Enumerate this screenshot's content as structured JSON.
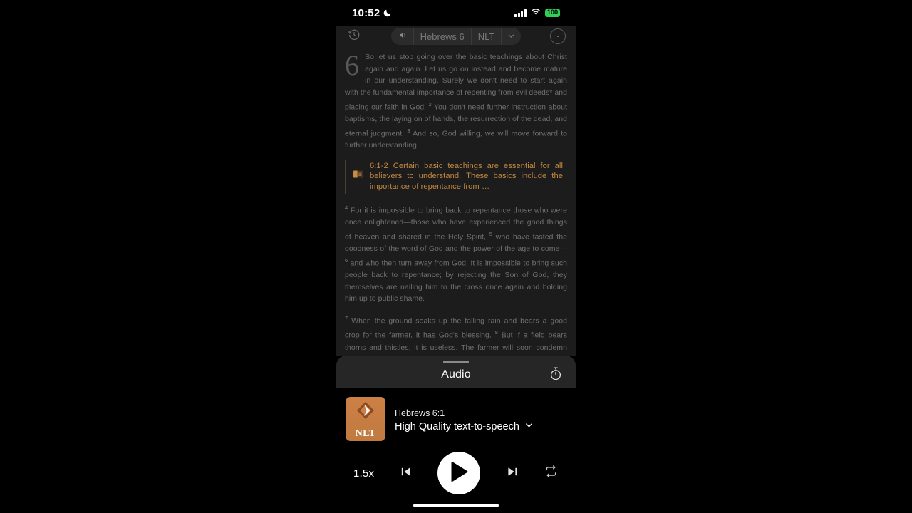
{
  "status_bar": {
    "time": "10:52",
    "moon_icon": "crescent-moon-icon",
    "signal_icon": "cellular-signal-icon",
    "wifi_icon": "wifi-icon",
    "battery_level": "100"
  },
  "nav_bar": {
    "history_icon": "clock-history-icon",
    "speaker_icon": "speaker-volume-icon",
    "reference": "Hebrews 6",
    "translation": "NLT",
    "chevron_icon": "chevron-down-icon",
    "more_icon": "more-options-icon"
  },
  "passage": {
    "chapter_number": "6",
    "paragraph_1": "So let us stop going over the basic teachings about Christ again and again. Let us go on instead and become mature in our understanding. Surely we don't need to start again with the fundamental importance of repenting from evil deeds* and placing our faith in God.",
    "verse_2_marker": "2",
    "paragraph_1b": "You don't need further instruction about baptisms, the laying on of hands, the resurrection of the dead, and eternal judgment.",
    "verse_3_marker": "3",
    "paragraph_1c": "And so, God willing, we will move forward to further understanding.",
    "callout": {
      "icon": "open-book-icon",
      "text": "6:1-2 Certain basic teachings are essential for all believers to understand. These basics include the importance of repentance from …"
    },
    "verse_4_marker": "4",
    "paragraph_2": "For it is impossible to bring back to repentance those who were once enlightened—those who have experienced the good things of heaven and shared in the Holy Spirit,",
    "verse_5_marker": "5",
    "paragraph_2b": "who have tasted the goodness of the word of God and the power of the age to come—",
    "verse_6_marker": "6",
    "paragraph_2c": "and who then turn away from God. It is impossible to bring such people back to repentance; by rejecting the Son of God, they themselves are nailing him to the cross once again and holding him up to public shame.",
    "verse_7_marker": "7",
    "paragraph_3": "When the ground soaks up the falling rain and bears a good crop for the farmer, it has God's blessing.",
    "verse_8_marker": "8",
    "paragraph_3b": "But if a field bears thorns and thistles, it is useless. The farmer will soon condemn that field and burn it."
  },
  "audio_sheet": {
    "grabber": "drag-handle",
    "title": "Audio",
    "timer_icon": "sleep-timer-icon",
    "track": {
      "artwork_label": "NLT",
      "artwork_logo": "nlt-diamond-logo",
      "reference": "Hebrews 6:1",
      "voice": "High Quality text-to-speech",
      "voice_chevron_icon": "chevron-down-icon"
    },
    "controls": {
      "speed": "1.5x",
      "previous_icon": "skip-previous-icon",
      "play_icon": "play-icon",
      "next_icon": "skip-next-icon",
      "repeat_icon": "repeat-icon"
    }
  },
  "home_indicator": "home-indicator",
  "colors": {
    "accent_orange": "#c2863f",
    "artwork_orange": "#cd8046",
    "battery_green": "#30d158",
    "sheet_gray": "#262626",
    "reader_bg": "#1c1c1c"
  }
}
